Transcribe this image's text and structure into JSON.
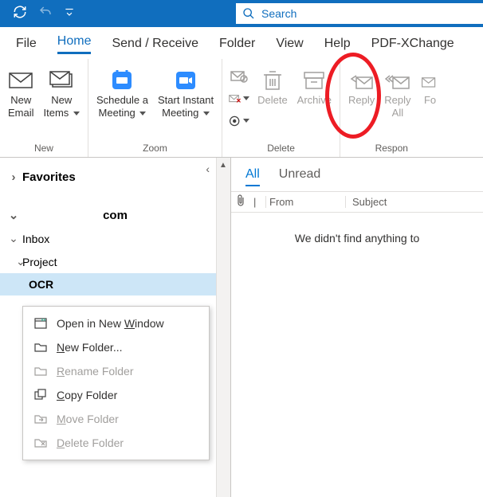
{
  "titlebar": {
    "search_placeholder": "Search"
  },
  "tabs": {
    "file": "File",
    "home": "Home",
    "sendreceive": "Send / Receive",
    "folder": "Folder",
    "view": "View",
    "help": "Help",
    "pdf": "PDF-XChange"
  },
  "ribbon": {
    "new_email": "New\nEmail",
    "new_items": "New\nItems",
    "schedule": "Schedule a\nMeeting",
    "start_instant": "Start Instant\nMeeting",
    "delete": "Delete",
    "archive": "Archive",
    "reply": "Reply",
    "reply_all": "Reply\nAll",
    "forward": "Fo",
    "group_new": "New",
    "group_zoom": "Zoom",
    "group_delete": "Delete",
    "group_respond": "Respon"
  },
  "nav": {
    "favorites": "Favorites",
    "account": "com",
    "inbox": "Inbox",
    "project": "Project",
    "ocr": "OCR"
  },
  "ctx": {
    "open": "Open in New Window",
    "new_folder": "New Folder...",
    "rename": "Rename Folder",
    "copy": "Copy Folder",
    "move": "Move Folder",
    "delete": "Delete Folder"
  },
  "msglist": {
    "filter_all": "All",
    "filter_unread": "Unread",
    "col_from": "From",
    "col_subject": "Subject",
    "empty": "We didn't find anything to"
  }
}
